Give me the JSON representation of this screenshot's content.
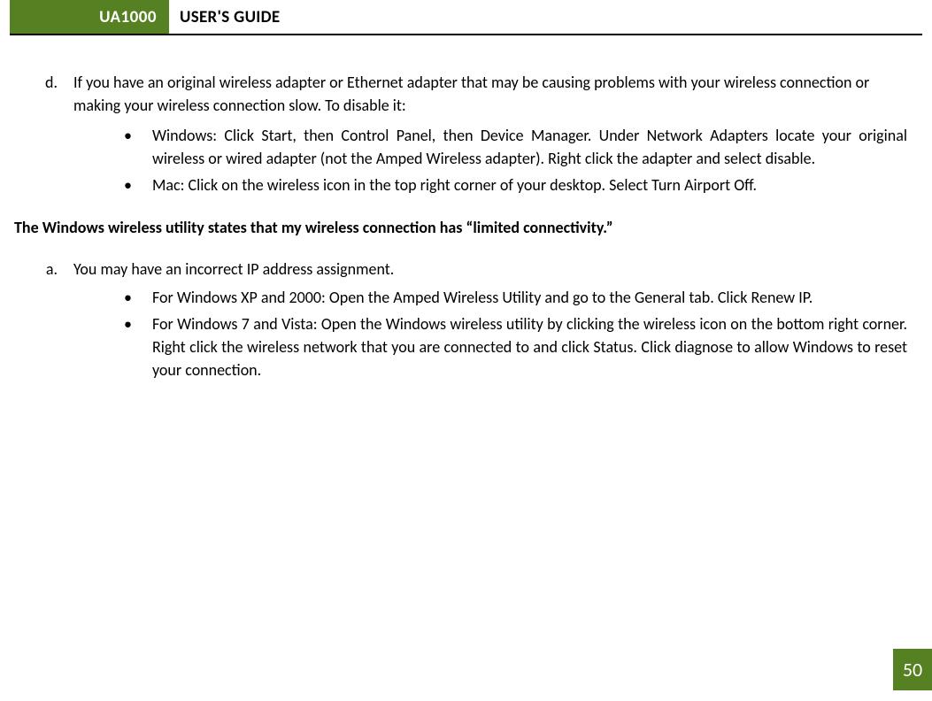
{
  "header": {
    "badge": "UA1000",
    "title": "USER'S GUIDE"
  },
  "content": {
    "item_d": {
      "marker": "d.",
      "text": "If you have an original wireless adapter or Ethernet adapter that may be causing problems with your wireless connection or making your wireless connection slow. To disable it:"
    },
    "item_d_sub": [
      "Windows: Click Start, then Control Panel, then Device Manager. Under Network Adapters locate your original wireless or wired adapter (not the Amped Wireless adapter). Right click the adapter and select disable.",
      "Mac: Click on the wireless icon in the top right corner of your desktop. Select Turn Airport Off."
    ],
    "section_heading": "The Windows wireless utility states that my wireless connection has “limited connectivity.”",
    "item_a": {
      "marker": "a.",
      "text": "You may have an incorrect IP address assignment."
    },
    "item_a_sub": [
      "For Windows XP and 2000: Open the Amped Wireless Utility and go to the General tab. Click Renew IP.",
      "For Windows 7 and Vista: Open the Windows wireless utility by clicking the wireless icon on the bottom right corner. Right click the wireless network that you are connected to and click Status. Click diagnose to allow Windows to reset your connection."
    ]
  },
  "page_number": "50",
  "bullet_char": "•"
}
